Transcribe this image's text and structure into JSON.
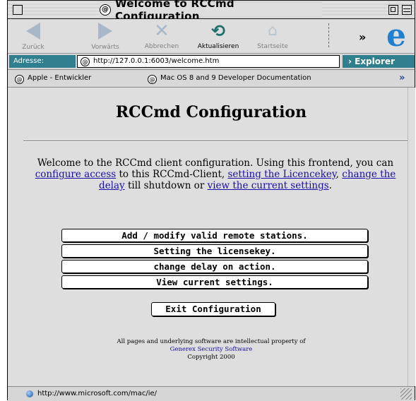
{
  "window": {
    "title": "Welcome to RCCmd Configuration"
  },
  "toolbar": {
    "back": "Zurück",
    "forward": "Vorwärts",
    "stop": "Abbrechen",
    "refresh": "Aktualisieren",
    "home": "Startseite",
    "more": "»"
  },
  "address": {
    "label": "Adresse:",
    "url": "http://127.0.0.1:6003/welcome.htm",
    "explorer_tab": "› Explorer"
  },
  "favorites": {
    "items": [
      {
        "label": "Apple - Entwickler"
      },
      {
        "label": "Mac OS 8 and 9 Developer Documentation"
      }
    ],
    "more": "»"
  },
  "page": {
    "title": "RCCmd Configuration",
    "intro": {
      "text1": "Welcome to the RCCmd client configuration. Using this frontend, you can ",
      "link1": "configure access",
      "text2": " to this RCCmd-Client, ",
      "link2": "setting the Licencekey",
      "text3": ", ",
      "link3": "change the delay",
      "text4": " till shutdown or ",
      "link4": "view the current settings",
      "text5": "."
    },
    "buttons": [
      {
        "label": "Add / modify valid remote stations."
      },
      {
        "label": "Setting the licensekey."
      },
      {
        "label": "change delay on action."
      },
      {
        "label": "View current settings."
      }
    ],
    "exit_button": "Exit Configuration",
    "footer": {
      "line1": "All pages and underlying software are intellectual property of",
      "company": "Generex Security Software",
      "copyright": "Copyright 2000"
    }
  },
  "status": {
    "url": "http://www.microsoft.com/mac/ie/"
  }
}
